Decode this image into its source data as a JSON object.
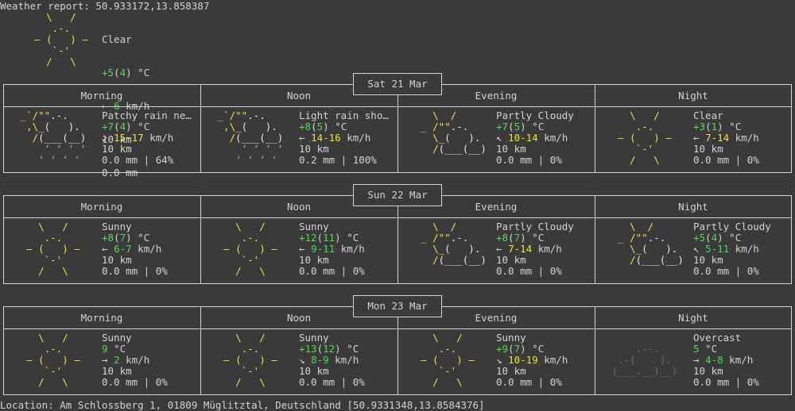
{
  "header": {
    "text": "Weather report: 50.933172,13.858387"
  },
  "current": {
    "icon": "sunny-icon",
    "condition": "Clear",
    "temp": "+5",
    "feels": "4",
    "temp_unit": " °C",
    "wind_arrow": "←",
    "wind": "6",
    "wind_unit": " km/h",
    "visibility": "10 km",
    "precip": "0.0 mm"
  },
  "slot_names": [
    "Morning",
    "Noon",
    "Evening",
    "Night"
  ],
  "days": [
    {
      "date": "Sat 21 Mar",
      "slots": [
        {
          "icon": "patchy-rain-icon",
          "condition": "Patchy rain ne…",
          "temp": "+7",
          "feels": "4",
          "temp_unit": " °C",
          "wind_arrow": "↙",
          "wind": "15-17",
          "wind_unit": " km/h",
          "visibility": "10 km",
          "precip": "0.0 mm | 64%"
        },
        {
          "icon": "light-rain-shower-icon",
          "condition": "Light rain sho…",
          "temp": "+8",
          "feels": "5",
          "temp_unit": " °C",
          "wind_arrow": "←",
          "wind": "14-16",
          "wind_unit": " km/h",
          "visibility": "10 km",
          "precip": "0.2 mm | 100%"
        },
        {
          "icon": "partly-cloudy-icon",
          "condition": "Partly Cloudy",
          "temp": "+7",
          "feels": "5",
          "temp_unit": " °C",
          "wind_arrow": "↖",
          "wind": "10-14",
          "wind_unit": " km/h",
          "visibility": "10 km",
          "precip": "0.0 mm | 0%"
        },
        {
          "icon": "sunny-icon",
          "condition": "Clear",
          "temp": "+3",
          "feels": "1",
          "temp_unit": " °C",
          "wind_arrow": "←",
          "wind": "7-14",
          "wind_unit": " km/h",
          "visibility": "10 km",
          "precip": "0.0 mm | 0%"
        }
      ]
    },
    {
      "date": "Sun 22 Mar",
      "slots": [
        {
          "icon": "sunny-icon",
          "condition": "Sunny",
          "temp": "+8",
          "feels": "7",
          "temp_unit": " °C",
          "wind_arrow": "←",
          "wind": "6-7",
          "wind_unit": " km/h",
          "visibility": "10 km",
          "precip": "0.0 mm | 0%"
        },
        {
          "icon": "sunny-icon",
          "condition": "Sunny",
          "temp": "+12",
          "feels": "11",
          "temp_unit": " °C",
          "wind_arrow": "←",
          "wind": "9-11",
          "wind_unit": " km/h",
          "visibility": "10 km",
          "precip": "0.0 mm | 0%"
        },
        {
          "icon": "partly-cloudy-icon",
          "condition": "Partly Cloudy",
          "temp": "+8",
          "feels": "7",
          "temp_unit": " °C",
          "wind_arrow": "←",
          "wind": "7-14",
          "wind_unit": " km/h",
          "visibility": "10 km",
          "precip": "0.0 mm | 0%"
        },
        {
          "icon": "partly-cloudy-icon",
          "condition": "Partly Cloudy",
          "temp": "+5",
          "feels": "4",
          "temp_unit": " °C",
          "wind_arrow": "↖",
          "wind": "5-11",
          "wind_unit": " km/h",
          "visibility": "10 km",
          "precip": "0.0 mm | 0%"
        }
      ]
    },
    {
      "date": "Mon 23 Mar",
      "slots": [
        {
          "icon": "sunny-icon",
          "condition": "Sunny",
          "temp": "9",
          "feels": "",
          "temp_unit": " °C",
          "wind_arrow": "→",
          "wind": "2",
          "wind_unit": " km/h",
          "visibility": "10 km",
          "precip": "0.0 mm | 0%"
        },
        {
          "icon": "sunny-icon",
          "condition": "Sunny",
          "temp": "+13",
          "feels": "12",
          "temp_unit": " °C",
          "wind_arrow": "↘",
          "wind": "8-9",
          "wind_unit": " km/h",
          "visibility": "10 km",
          "precip": "0.0 mm | 0%"
        },
        {
          "icon": "sunny-icon",
          "condition": "Sunny",
          "temp": "+9",
          "feels": "7",
          "temp_unit": " °C",
          "wind_arrow": "↘",
          "wind": "10-19",
          "wind_unit": " km/h",
          "visibility": "10 km",
          "precip": "0.0 mm | 0%"
        },
        {
          "icon": "overcast-icon",
          "condition": "Overcast",
          "temp": "5",
          "feels": "",
          "temp_unit": " °C",
          "wind_arrow": "→",
          "wind": "4-8",
          "wind_unit": " km/h",
          "visibility": "10 km",
          "precip": "0.0 mm | 0%"
        }
      ]
    }
  ],
  "footer": {
    "text": "Location: Am Schlossberg 1, 01809 Müglitztal, Deutschland [50.9331348,13.8584376]"
  }
}
